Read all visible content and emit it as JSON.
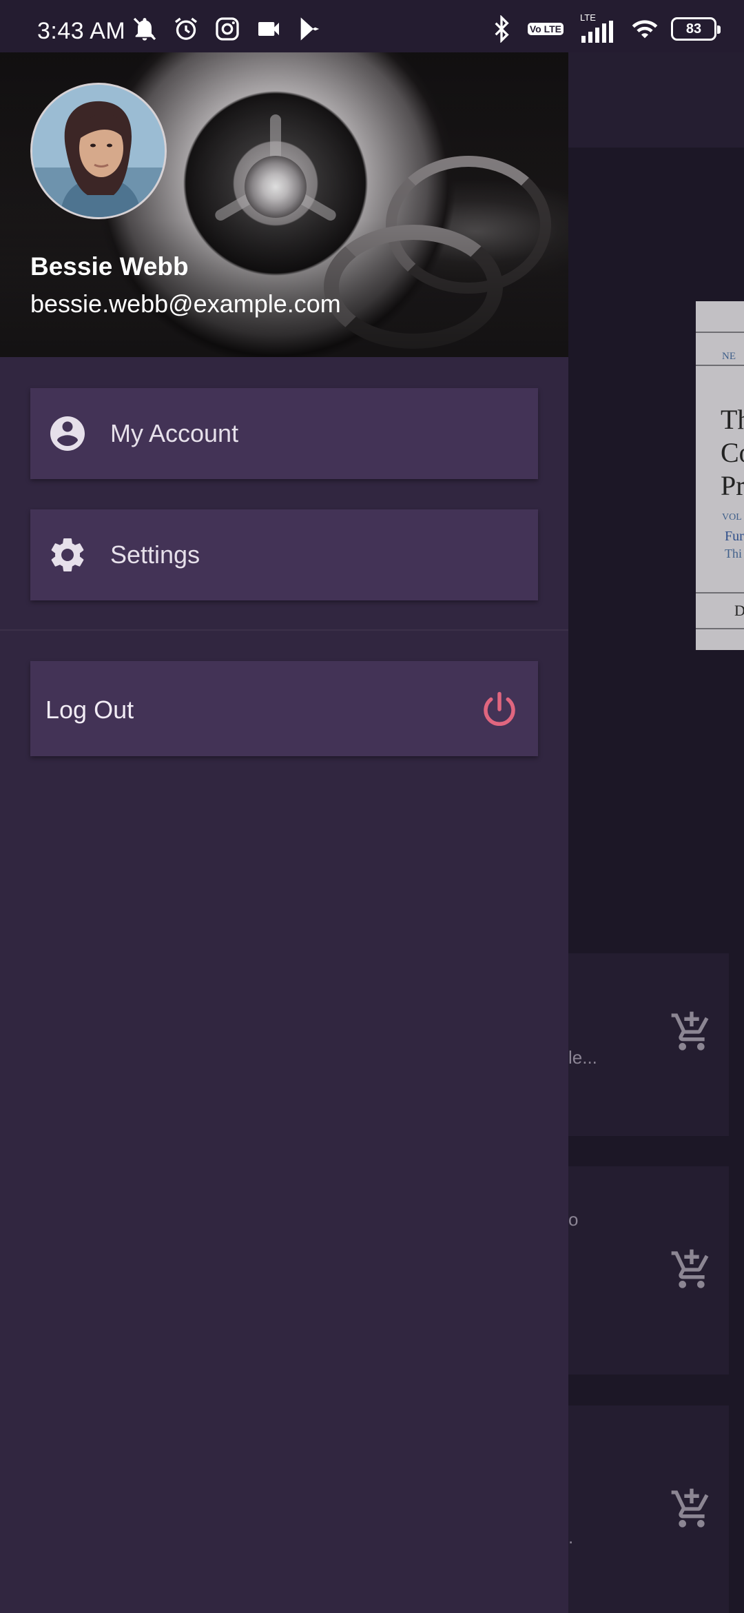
{
  "status_bar": {
    "time": "3:43 AM",
    "left_icons": [
      "mute-icon",
      "alarm-icon",
      "instagram-icon",
      "video-icon",
      "play-store-icon"
    ],
    "right_icons": [
      "bluetooth-icon",
      "volte-icon",
      "signal-icon",
      "wifi-icon",
      "battery-icon"
    ],
    "volte_label": "Vo LTE",
    "lte_label": "LTE",
    "battery": "83"
  },
  "drawer": {
    "user": {
      "name": "Bessie Webb",
      "email": "bessie.webb@example.com"
    },
    "menu": [
      {
        "label": "My Account",
        "icon": "account-circle-icon"
      },
      {
        "label": "Settings",
        "icon": "gear-icon"
      }
    ],
    "logout": {
      "label": "Log Out",
      "icon": "power-icon"
    }
  },
  "background_app": {
    "doc_snippets": [
      "NE",
      "Th",
      "Co",
      "Pr",
      "VOL",
      "Fur",
      "Thi",
      "D"
    ],
    "card_truncations": [
      "le...",
      "o",
      "."
    ],
    "card_icons": [
      "add-to-cart-icon",
      "add-to-cart-icon",
      "add-to-cart-icon"
    ]
  },
  "colors": {
    "drawer_bg": "#312640",
    "card_bg": "#433356",
    "power_accent": "#e0667f",
    "scrim_bg": "#1c1726"
  }
}
